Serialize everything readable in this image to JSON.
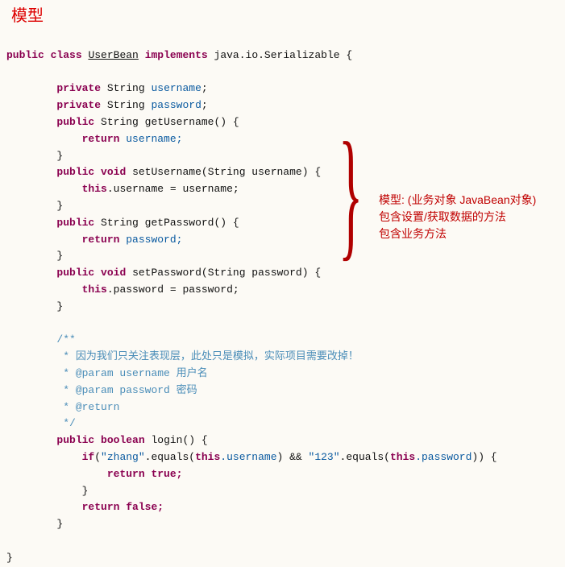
{
  "title": "模型",
  "code": {
    "decl_public": "public",
    "decl_class": "class",
    "decl_name": "UserBean",
    "decl_impl": "implements",
    "decl_iface": "java.io.Serializable {",
    "priv": "private",
    "pub": "public",
    "string_t": "String",
    "void_t": "void",
    "bool_t": "boolean",
    "username": "username",
    "password": "password",
    "getUsername": "getUsername() {",
    "ret": "return",
    "ret_username": "username;",
    "ret_password": "password;",
    "setUsername_sig": "setUsername(String username) {",
    "this": "this",
    "assign_username": ".username = username;",
    "getPassword": "getPassword() {",
    "setPassword_sig": "setPassword(String password) {",
    "assign_password": ".password = password;",
    "close": "}",
    "semi": ";",
    "comment_open": "/**",
    "comment_l1": " * 因为我们只关注表现层，此处只是模拟，实际项目需要改掉！",
    "comment_l2": " * @param username 用户名",
    "comment_l3": " * @param password 密码",
    "comment_l4": " * @return",
    "comment_close": " */",
    "login_sig": "login() {",
    "if": "if",
    "str_zhang": "\"zhang\"",
    "eq1": ".equals(",
    "dot_username": ".username",
    "and": ") && ",
    "str_123": "\"123\"",
    "dot_password": ".password",
    "tail": ")) {",
    "ret_true": "true;",
    "ret_false": "false;"
  },
  "annot": {
    "l1": "模型: (业务对象 JavaBean对象)",
    "l2": "包含设置/获取数据的方法",
    "l3": "包含业务方法"
  }
}
